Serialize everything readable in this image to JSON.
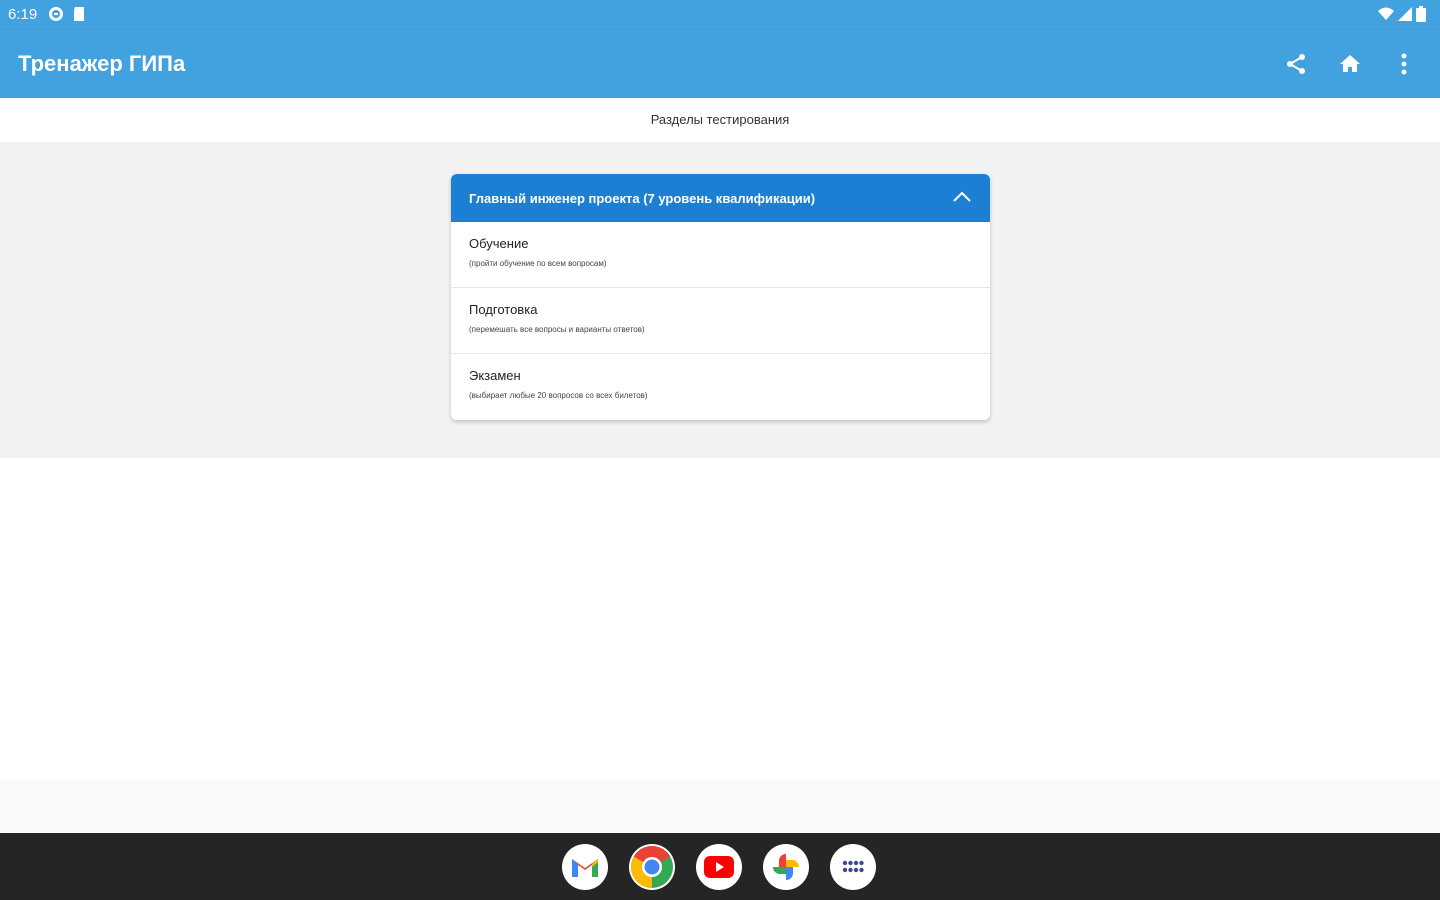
{
  "status_bar": {
    "time": "6:19",
    "left_icons": [
      "assistant-icon",
      "sd-card-icon"
    ],
    "right_icons": [
      "wifi-icon",
      "cell-signal-icon",
      "battery-icon"
    ]
  },
  "app_bar": {
    "title": "Тренажер ГИПа",
    "actions": [
      "share-icon",
      "home-icon",
      "more-vert-icon"
    ]
  },
  "subheader": {
    "text": "Разделы тестирования"
  },
  "card": {
    "header": "Главный инженер проекта (7 уровень квалификации)",
    "items": [
      {
        "title": "Обучение",
        "subtitle": "(пройти обучение по всем вопросам)"
      },
      {
        "title": "Подготовка",
        "subtitle": "(перемешать все вопросы и варианты ответов)"
      },
      {
        "title": "Экзамен",
        "subtitle": "(выбирает любые 20 вопросов со всех билетов)"
      }
    ]
  },
  "dock": [
    "gmail-icon",
    "chrome-icon",
    "youtube-icon",
    "photos-icon",
    "app-launcher-icon"
  ],
  "colors": {
    "app_bar": "#42a2df",
    "card_header": "#1b80d4",
    "content_bg": "#f2f2f2",
    "taskbar": "#252526"
  }
}
